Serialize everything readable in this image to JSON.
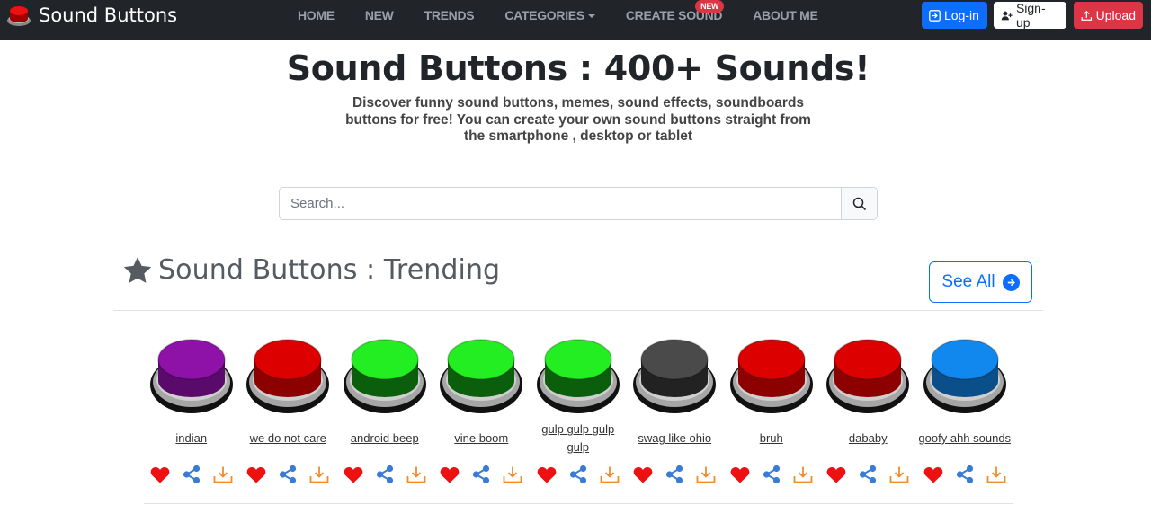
{
  "brand": {
    "name": "Sound Buttons",
    "logo_icon": "red-button-logo-icon"
  },
  "nav": {
    "items": [
      {
        "label": "HOME"
      },
      {
        "label": "NEW"
      },
      {
        "label": "TRENDS"
      },
      {
        "label": "CATEGORIES",
        "has_dropdown": true
      },
      {
        "label": "CREATE SOUND",
        "badge": "NEW"
      },
      {
        "label": "ABOUT ME"
      }
    ],
    "login_label": "Log-in",
    "signup_label": "Sign-up",
    "upload_label": "Upload"
  },
  "hero": {
    "title": "Sound Buttons : 400+ Sounds!",
    "description": "Discover funny sound buttons, memes, sound effects, soundboards buttons for free! You can create your own sound buttons straight from the smartphone , desktop or tablet"
  },
  "search": {
    "placeholder": "Search...",
    "icon": "search-icon"
  },
  "trending": {
    "title": "Sound Buttons : Trending",
    "icon": "star-icon",
    "see_all_label": "See All",
    "sounds": [
      {
        "label": "indian",
        "color": "#8e11a8",
        "dark": "#5a0a6b"
      },
      {
        "label": "we do not care",
        "color": "#dd0000",
        "dark": "#8c0000"
      },
      {
        "label": "android beep",
        "color": "#22ee22",
        "dark": "#0b5e0b"
      },
      {
        "label": "vine boom",
        "color": "#22ee22",
        "dark": "#0b5e0b"
      },
      {
        "label": "gulp gulp gulp gulp",
        "color": "#22ee22",
        "dark": "#0b5e0b"
      },
      {
        "label": "swag like ohio",
        "color": "#4a4a4a",
        "dark": "#222222"
      },
      {
        "label": "bruh",
        "color": "#dd0000",
        "dark": "#8c0000"
      },
      {
        "label": "dababy",
        "color": "#dd0000",
        "dark": "#8c0000"
      },
      {
        "label": "goofy ahh sounds",
        "color": "#1188ee",
        "dark": "#0a4f8a"
      }
    ]
  },
  "colors": {
    "navbar_bg": "#212529",
    "primary": "#0d6efd",
    "danger": "#dc3545",
    "heart": "#ee1111",
    "share": "#3a7bd5",
    "download": "#f08c2e"
  }
}
